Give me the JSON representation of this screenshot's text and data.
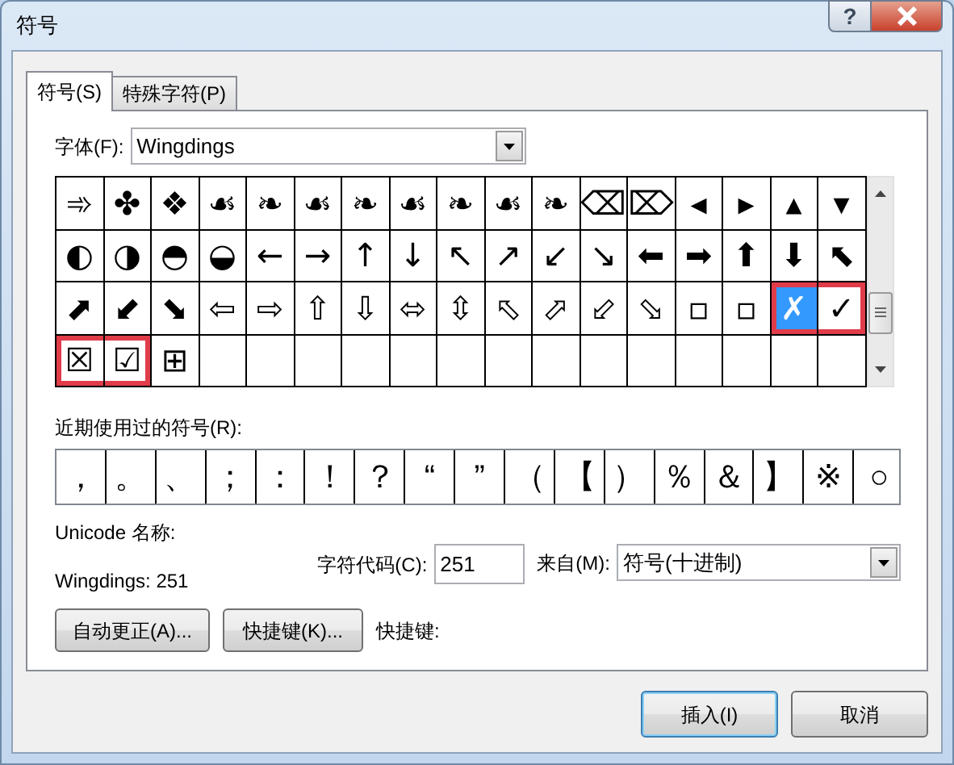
{
  "window": {
    "title": "符号",
    "help": "?"
  },
  "tabs": [
    {
      "label": "符号(S)",
      "selected": true
    },
    {
      "label": "特殊字符(P)",
      "selected": false
    }
  ],
  "font": {
    "label": "字体(F):",
    "value": "Wingdings"
  },
  "symbols": [
    [
      {
        "glyph": "➾",
        "selected": false,
        "highlighted": false
      },
      {
        "glyph": "✤",
        "selected": false,
        "highlighted": false
      },
      {
        "glyph": "❖",
        "selected": false,
        "highlighted": false
      },
      {
        "glyph": "☙",
        "selected": false,
        "highlighted": false
      },
      {
        "glyph": "❧",
        "selected": false,
        "highlighted": false
      },
      {
        "glyph": "☙",
        "selected": false,
        "highlighted": false
      },
      {
        "glyph": "❧",
        "selected": false,
        "highlighted": false
      },
      {
        "glyph": "☙",
        "selected": false,
        "highlighted": false
      },
      {
        "glyph": "❧",
        "selected": false,
        "highlighted": false
      },
      {
        "glyph": "☙",
        "selected": false,
        "highlighted": false
      },
      {
        "glyph": "❧",
        "selected": false,
        "highlighted": false
      },
      {
        "glyph": "⌫",
        "selected": false,
        "highlighted": false
      },
      {
        "glyph": "⌦",
        "selected": false,
        "highlighted": false
      },
      {
        "glyph": "◂",
        "selected": false,
        "highlighted": false
      },
      {
        "glyph": "▸",
        "selected": false,
        "highlighted": false
      },
      {
        "glyph": "▴",
        "selected": false,
        "highlighted": false
      },
      {
        "glyph": "▾",
        "selected": false,
        "highlighted": false
      }
    ],
    [
      {
        "glyph": "◐",
        "selected": false,
        "highlighted": false
      },
      {
        "glyph": "◑",
        "selected": false,
        "highlighted": false
      },
      {
        "glyph": "◓",
        "selected": false,
        "highlighted": false
      },
      {
        "glyph": "◒",
        "selected": false,
        "highlighted": false
      },
      {
        "glyph": "←",
        "selected": false,
        "highlighted": false
      },
      {
        "glyph": "→",
        "selected": false,
        "highlighted": false
      },
      {
        "glyph": "↑",
        "selected": false,
        "highlighted": false
      },
      {
        "glyph": "↓",
        "selected": false,
        "highlighted": false
      },
      {
        "glyph": "↖",
        "selected": false,
        "highlighted": false
      },
      {
        "glyph": "↗",
        "selected": false,
        "highlighted": false
      },
      {
        "glyph": "↙",
        "selected": false,
        "highlighted": false
      },
      {
        "glyph": "↘",
        "selected": false,
        "highlighted": false
      },
      {
        "glyph": "⬅",
        "selected": false,
        "highlighted": false
      },
      {
        "glyph": "➡",
        "selected": false,
        "highlighted": false
      },
      {
        "glyph": "⬆",
        "selected": false,
        "highlighted": false
      },
      {
        "glyph": "⬇",
        "selected": false,
        "highlighted": false
      },
      {
        "glyph": "⬉",
        "selected": false,
        "highlighted": false
      }
    ],
    [
      {
        "glyph": "⬈",
        "selected": false,
        "highlighted": false
      },
      {
        "glyph": "⬋",
        "selected": false,
        "highlighted": false
      },
      {
        "glyph": "⬊",
        "selected": false,
        "highlighted": false
      },
      {
        "glyph": "⇦",
        "selected": false,
        "highlighted": false
      },
      {
        "glyph": "⇨",
        "selected": false,
        "highlighted": false
      },
      {
        "glyph": "⇧",
        "selected": false,
        "highlighted": false
      },
      {
        "glyph": "⇩",
        "selected": false,
        "highlighted": false
      },
      {
        "glyph": "⬄",
        "selected": false,
        "highlighted": false
      },
      {
        "glyph": "⇳",
        "selected": false,
        "highlighted": false
      },
      {
        "glyph": "⬁",
        "selected": false,
        "highlighted": false
      },
      {
        "glyph": "⬀",
        "selected": false,
        "highlighted": false
      },
      {
        "glyph": "⬃",
        "selected": false,
        "highlighted": false
      },
      {
        "glyph": "⬂",
        "selected": false,
        "highlighted": false
      },
      {
        "glyph": "▫",
        "selected": false,
        "highlighted": false
      },
      {
        "glyph": "▫",
        "selected": false,
        "highlighted": false
      },
      {
        "glyph": "✗",
        "selected": true,
        "highlighted": true
      },
      {
        "glyph": "✓",
        "selected": false,
        "highlighted": true
      }
    ],
    [
      {
        "glyph": "☒",
        "selected": false,
        "highlighted": true
      },
      {
        "glyph": "☑",
        "selected": false,
        "highlighted": true
      },
      {
        "glyph": "⊞",
        "selected": false,
        "highlighted": false
      },
      {
        "selected": false,
        "highlighted": false
      },
      {
        "selected": false,
        "highlighted": false
      },
      {
        "selected": false,
        "highlighted": false
      },
      {
        "selected": false,
        "highlighted": false
      },
      {
        "selected": false,
        "highlighted": false
      },
      {
        "selected": false,
        "highlighted": false
      },
      {
        "selected": false,
        "highlighted": false
      },
      {
        "selected": false,
        "highlighted": false
      },
      {
        "selected": false,
        "highlighted": false
      },
      {
        "selected": false,
        "highlighted": false
      },
      {
        "selected": false,
        "highlighted": false
      },
      {
        "selected": false,
        "highlighted": false
      },
      {
        "selected": false,
        "highlighted": false
      },
      {
        "selected": false,
        "highlighted": false
      }
    ]
  ],
  "recent": {
    "label": "近期使用过的符号(R):",
    "symbols": [
      "，",
      "。",
      "、",
      "；",
      "：",
      "！",
      "？",
      "“",
      "”",
      "（",
      "【",
      "）",
      "％",
      "＆",
      "】",
      "※",
      "○"
    ]
  },
  "unicode_name": {
    "label": "Unicode 名称:",
    "value": "Wingdings: 251"
  },
  "char_code": {
    "label": "字符代码(C):",
    "value": "251"
  },
  "from": {
    "label": "来自(M):",
    "value": "符号(十进制)"
  },
  "autocorrect_button": "自动更正(A)...",
  "shortcut_button": "快捷键(K)...",
  "shortcut_label": "快捷键:",
  "footer_buttons": [
    {
      "label": "插入(I)",
      "default": true
    },
    {
      "label": "取消",
      "default": false
    }
  ]
}
